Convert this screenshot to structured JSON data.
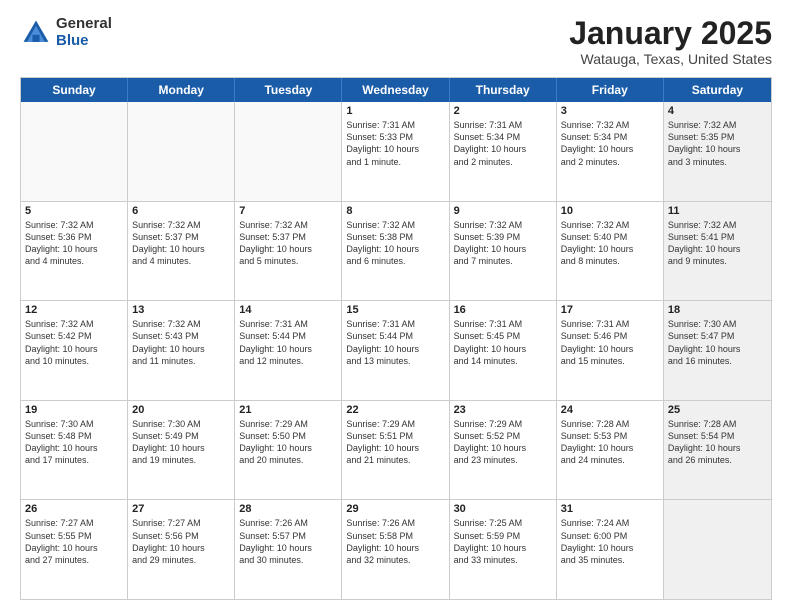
{
  "logo": {
    "general": "General",
    "blue": "Blue"
  },
  "title": "January 2025",
  "location": "Watauga, Texas, United States",
  "day_headers": [
    "Sunday",
    "Monday",
    "Tuesday",
    "Wednesday",
    "Thursday",
    "Friday",
    "Saturday"
  ],
  "weeks": [
    [
      {
        "day": "",
        "empty": true
      },
      {
        "day": "",
        "empty": true
      },
      {
        "day": "",
        "empty": true
      },
      {
        "day": "1",
        "text": "Sunrise: 7:31 AM\nSunset: 5:33 PM\nDaylight: 10 hours\nand 1 minute."
      },
      {
        "day": "2",
        "text": "Sunrise: 7:31 AM\nSunset: 5:34 PM\nDaylight: 10 hours\nand 2 minutes."
      },
      {
        "day": "3",
        "text": "Sunrise: 7:32 AM\nSunset: 5:34 PM\nDaylight: 10 hours\nand 2 minutes."
      },
      {
        "day": "4",
        "text": "Sunrise: 7:32 AM\nSunset: 5:35 PM\nDaylight: 10 hours\nand 3 minutes.",
        "shaded": true
      }
    ],
    [
      {
        "day": "5",
        "text": "Sunrise: 7:32 AM\nSunset: 5:36 PM\nDaylight: 10 hours\nand 4 minutes."
      },
      {
        "day": "6",
        "text": "Sunrise: 7:32 AM\nSunset: 5:37 PM\nDaylight: 10 hours\nand 4 minutes."
      },
      {
        "day": "7",
        "text": "Sunrise: 7:32 AM\nSunset: 5:37 PM\nDaylight: 10 hours\nand 5 minutes."
      },
      {
        "day": "8",
        "text": "Sunrise: 7:32 AM\nSunset: 5:38 PM\nDaylight: 10 hours\nand 6 minutes."
      },
      {
        "day": "9",
        "text": "Sunrise: 7:32 AM\nSunset: 5:39 PM\nDaylight: 10 hours\nand 7 minutes."
      },
      {
        "day": "10",
        "text": "Sunrise: 7:32 AM\nSunset: 5:40 PM\nDaylight: 10 hours\nand 8 minutes."
      },
      {
        "day": "11",
        "text": "Sunrise: 7:32 AM\nSunset: 5:41 PM\nDaylight: 10 hours\nand 9 minutes.",
        "shaded": true
      }
    ],
    [
      {
        "day": "12",
        "text": "Sunrise: 7:32 AM\nSunset: 5:42 PM\nDaylight: 10 hours\nand 10 minutes."
      },
      {
        "day": "13",
        "text": "Sunrise: 7:32 AM\nSunset: 5:43 PM\nDaylight: 10 hours\nand 11 minutes."
      },
      {
        "day": "14",
        "text": "Sunrise: 7:31 AM\nSunset: 5:44 PM\nDaylight: 10 hours\nand 12 minutes."
      },
      {
        "day": "15",
        "text": "Sunrise: 7:31 AM\nSunset: 5:44 PM\nDaylight: 10 hours\nand 13 minutes."
      },
      {
        "day": "16",
        "text": "Sunrise: 7:31 AM\nSunset: 5:45 PM\nDaylight: 10 hours\nand 14 minutes."
      },
      {
        "day": "17",
        "text": "Sunrise: 7:31 AM\nSunset: 5:46 PM\nDaylight: 10 hours\nand 15 minutes."
      },
      {
        "day": "18",
        "text": "Sunrise: 7:30 AM\nSunset: 5:47 PM\nDaylight: 10 hours\nand 16 minutes.",
        "shaded": true
      }
    ],
    [
      {
        "day": "19",
        "text": "Sunrise: 7:30 AM\nSunset: 5:48 PM\nDaylight: 10 hours\nand 17 minutes."
      },
      {
        "day": "20",
        "text": "Sunrise: 7:30 AM\nSunset: 5:49 PM\nDaylight: 10 hours\nand 19 minutes."
      },
      {
        "day": "21",
        "text": "Sunrise: 7:29 AM\nSunset: 5:50 PM\nDaylight: 10 hours\nand 20 minutes."
      },
      {
        "day": "22",
        "text": "Sunrise: 7:29 AM\nSunset: 5:51 PM\nDaylight: 10 hours\nand 21 minutes."
      },
      {
        "day": "23",
        "text": "Sunrise: 7:29 AM\nSunset: 5:52 PM\nDaylight: 10 hours\nand 23 minutes."
      },
      {
        "day": "24",
        "text": "Sunrise: 7:28 AM\nSunset: 5:53 PM\nDaylight: 10 hours\nand 24 minutes."
      },
      {
        "day": "25",
        "text": "Sunrise: 7:28 AM\nSunset: 5:54 PM\nDaylight: 10 hours\nand 26 minutes.",
        "shaded": true
      }
    ],
    [
      {
        "day": "26",
        "text": "Sunrise: 7:27 AM\nSunset: 5:55 PM\nDaylight: 10 hours\nand 27 minutes."
      },
      {
        "day": "27",
        "text": "Sunrise: 7:27 AM\nSunset: 5:56 PM\nDaylight: 10 hours\nand 29 minutes."
      },
      {
        "day": "28",
        "text": "Sunrise: 7:26 AM\nSunset: 5:57 PM\nDaylight: 10 hours\nand 30 minutes."
      },
      {
        "day": "29",
        "text": "Sunrise: 7:26 AM\nSunset: 5:58 PM\nDaylight: 10 hours\nand 32 minutes."
      },
      {
        "day": "30",
        "text": "Sunrise: 7:25 AM\nSunset: 5:59 PM\nDaylight: 10 hours\nand 33 minutes."
      },
      {
        "day": "31",
        "text": "Sunrise: 7:24 AM\nSunset: 6:00 PM\nDaylight: 10 hours\nand 35 minutes."
      },
      {
        "day": "",
        "empty": true,
        "shaded": true
      }
    ]
  ]
}
